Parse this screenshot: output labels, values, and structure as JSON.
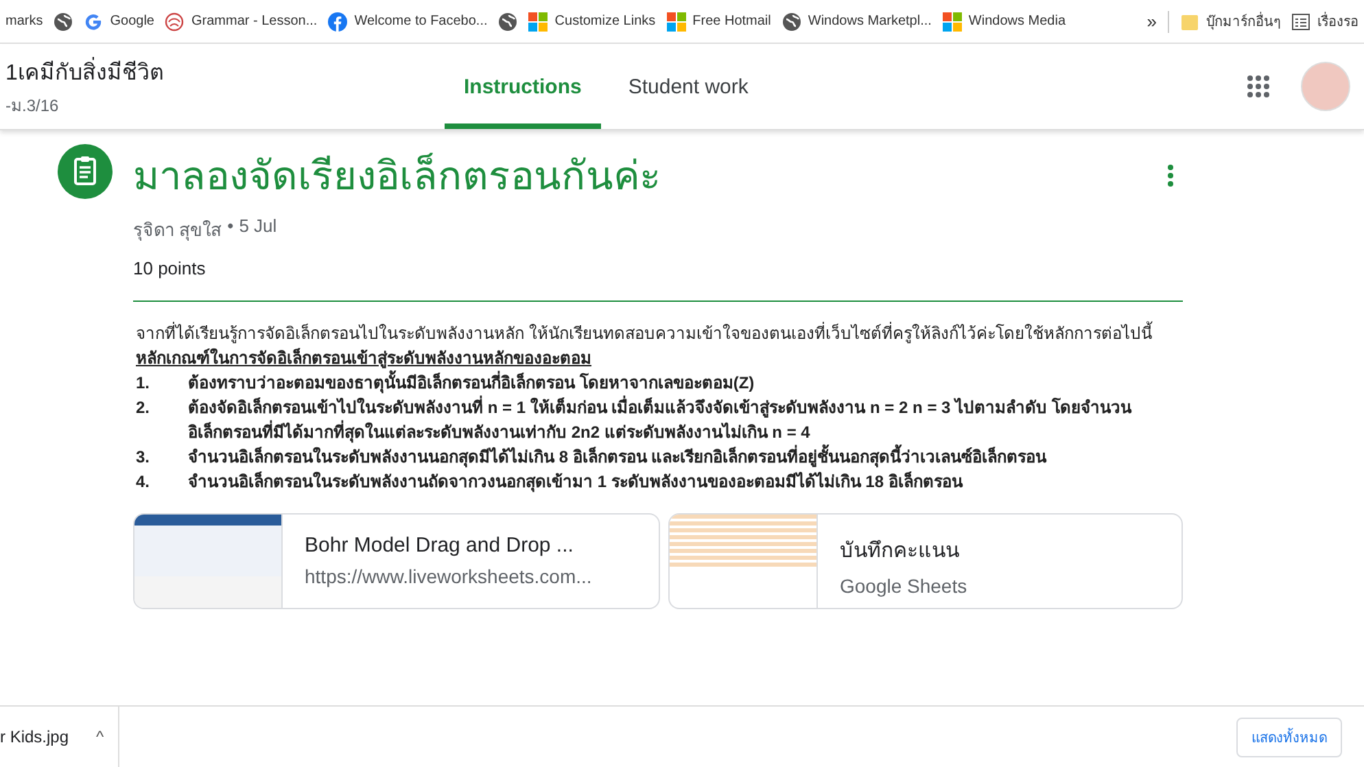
{
  "bookmarks": [
    {
      "kind": "text",
      "label": "marks"
    },
    {
      "kind": "globe"
    },
    {
      "kind": "google",
      "label": "Google"
    },
    {
      "kind": "grammar",
      "label": "Grammar - Lesson..."
    },
    {
      "kind": "facebook",
      "label": "Welcome to Facebo..."
    },
    {
      "kind": "globe"
    },
    {
      "kind": "windows",
      "label": "Customize Links"
    },
    {
      "kind": "windows",
      "label": "Free Hotmail"
    },
    {
      "kind": "globe",
      "label": "Windows Marketpl..."
    },
    {
      "kind": "windows",
      "label": "Windows Media"
    }
  ],
  "bookmarks_more": "»",
  "bookmarks_right": [
    {
      "kind": "folder",
      "label": "บุ๊กมาร์กอื่นๆ"
    },
    {
      "kind": "list",
      "label": "เรื่องรอ"
    }
  ],
  "header": {
    "class_title": "1เคมีกับสิ่งมีชีวิต",
    "class_section": "-ม.3/16"
  },
  "tabs": [
    {
      "label": "Instructions",
      "selected": true
    },
    {
      "label": "Student work",
      "selected": false
    }
  ],
  "assignment": {
    "title": "มาลองจัดเรียงอิเล็กตรอนกันค่ะ",
    "author": "รุจิดา สุขใส",
    "separator": "•",
    "date": "5 Jul",
    "points": "10 points",
    "intro": "จากที่ได้เรียนรู้การจัดอิเล็กตรอนไปในระดับพลังงานหลัก ให้นักเรียนทดสอบความเข้าใจของตนเองที่เว็บไซต์ที่ครูให้ลิงก์ไว้ค่ะโดยใช้หลักการต่อไปนี้",
    "heading": "หลักเกณฑ์ในการจัดอิเล็กตรอนเข้าสู่ระดับพลังงานหลักของอะตอม",
    "rules": [
      {
        "number": "1.",
        "text": "ต้องทราบว่าอะตอมของธาตุนั้นมีอิเล็กตรอนกี่อิเล็กตรอน โดยหาจากเลขอะตอม(Z)"
      },
      {
        "number": "2.",
        "text": "ต้องจัดอิเล็กตรอนเข้าไปในระดับพลังงานที่ n = 1 ให้เต็มก่อน เมื่อเต็มแล้วจึงจัดเข้าสู่ระดับพลังงาน n = 2 n = 3 ไปตามลำดับ โดยจำนวนอิเล็กตรอนที่มีได้มากที่สุดในแต่ละระดับพลังงานเท่ากับ 2n2 แต่ระดับพลังงานไม่เกิน n = 4"
      },
      {
        "number": "3.",
        "text": "จำนวนอิเล็กตรอนในระดับพลังงานนอกสุดมีได้ไม่เกิน 8 อิเล็กตรอน และเรียกอิเล็กตรอนที่อยู่ชั้นนอกสุดนี้ว่าเวเลนซ์อิเล็กตรอน"
      },
      {
        "number": "4.",
        "text": "จำนวนอิเล็กตรอนในระดับพลังงานถัดจากวงนอกสุดเข้ามา 1 ระดับพลังงานของอะตอมมีได้ไม่เกิน 18 อิเล็กตรอน"
      }
    ],
    "attachments": [
      {
        "kind": "link",
        "title": "Bohr Model Drag and Drop ...",
        "subtitle": "https://www.liveworksheets.com..."
      },
      {
        "kind": "sheet",
        "title": "บันทึกคะแนน",
        "subtitle": "Google Sheets"
      }
    ]
  },
  "downloads": {
    "file": "r Kids.jpg",
    "caret": "^",
    "show_all": "แสดงทั้งหมด"
  }
}
